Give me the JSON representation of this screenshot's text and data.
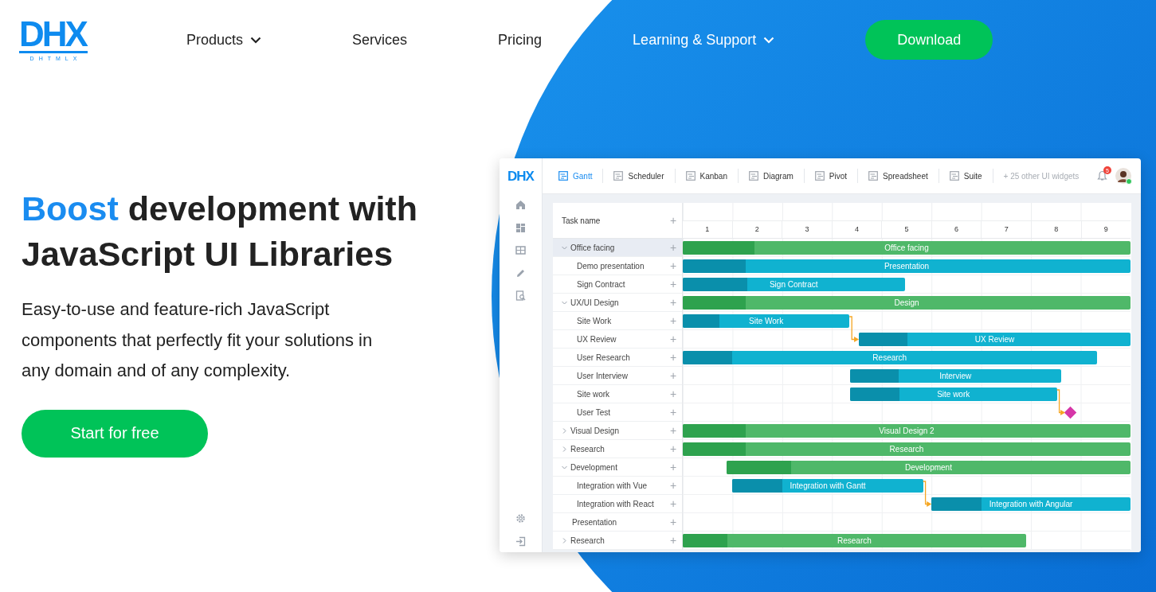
{
  "logo": {
    "mark": "DHX",
    "wordmark": "DHTMLX"
  },
  "nav": [
    {
      "label": "Products",
      "dropdown": true,
      "on_dark": false
    },
    {
      "label": "Services",
      "dropdown": false,
      "on_dark": false
    },
    {
      "label": "Pricing",
      "dropdown": false,
      "on_dark": false
    },
    {
      "label": "Learning & Support",
      "dropdown": true,
      "on_dark": true
    }
  ],
  "download_button": "Download",
  "hero": {
    "title_highlight": "Boost",
    "title_rest": "development with JavaScript UI Libraries",
    "text": "Easy-to-use and feature-rich JavaScript components that perfectly fit your solutions in any domain and of any complexity.",
    "button": "Start for free"
  },
  "app": {
    "logo": "DHX",
    "tabs": [
      {
        "label": "Gantt",
        "selected": true
      },
      {
        "label": "Scheduler",
        "selected": false
      },
      {
        "label": "Kanban",
        "selected": false
      },
      {
        "label": "Diagram",
        "selected": false
      },
      {
        "label": "Pivot",
        "selected": false
      },
      {
        "label": "Spreadsheet",
        "selected": false
      },
      {
        "label": "Suite",
        "selected": false
      }
    ],
    "more_link": "+ 25 other UI widgets",
    "notifications": "5",
    "user_online": true,
    "gantt": {
      "column_header": "Task name",
      "add_button": "+",
      "timeline": [
        "1",
        "2",
        "3",
        "4",
        "5",
        "6",
        "7",
        "8",
        "9"
      ],
      "rows": [
        {
          "name": "Office facing",
          "add_button": "+",
          "selected": true,
          "expanded": true,
          "bar": {
            "kind": "project",
            "label": "Office facing",
            "level": 0.16
          },
          "children": [
            {
              "name": "Demo presentation",
              "add_button": "+",
              "selected": false,
              "bar": {
                "kind": "task",
                "label": "Presentation",
                "level": 0.14
              }
            },
            {
              "name": "Sign Contract",
              "add_button": "+",
              "selected": false,
              "bar": {
                "kind": "task",
                "label": "Sign Contract",
                "level": 0.29
              }
            }
          ]
        },
        {
          "name": "UX/UI Design",
          "add_button": "+",
          "selected": false,
          "expanded": true,
          "bar": {
            "kind": "project",
            "label": "Design",
            "level": 0.14
          },
          "children": [
            {
              "name": "Site Work",
              "add_button": "+",
              "selected": false,
              "link_to_next": true,
              "bar": {
                "kind": "task",
                "label": "Site Work",
                "level": 0.22
              }
            },
            {
              "name": "UX Review",
              "add_button": "+",
              "selected": false,
              "bar": {
                "kind": "task",
                "label": "UX Review",
                "level": 0.18
              }
            },
            {
              "name": "User Research",
              "add_button": "+",
              "selected": false,
              "bar": {
                "kind": "task",
                "label": "Research",
                "level": 0.12
              }
            },
            {
              "name": "User Interview",
              "add_button": "+",
              "selected": false,
              "bar": {
                "kind": "task",
                "label": "Interview",
                "level": 0.23
              }
            },
            {
              "name": "Site work",
              "add_button": "+",
              "selected": false,
              "link_to_next": true,
              "bar": {
                "kind": "task",
                "label": "Site work",
                "level": 0.24
              }
            },
            {
              "name": "User Test",
              "add_button": "+",
              "selected": false,
              "bar": {
                "kind": "milestone"
              }
            }
          ]
        },
        {
          "name": "Visual Design",
          "add_button": "+",
          "selected": false,
          "expanded": false,
          "bar": {
            "kind": "project",
            "label": "Visual Design 2",
            "level": 0.14
          }
        },
        {
          "name": "Research",
          "add_button": "+",
          "selected": false,
          "expanded": false,
          "bar": {
            "kind": "project",
            "label": "Research",
            "level": 0.14
          }
        },
        {
          "name": "Development",
          "add_button": "+",
          "selected": false,
          "expanded": true,
          "bar": {
            "kind": "project",
            "label": "Development",
            "level": 0.16
          },
          "children": [
            {
              "name": "Integration with Vue",
              "add_button": "+",
              "selected": false,
              "link_to_next": true,
              "bar": {
                "kind": "task",
                "label": "Integration with Gantt",
                "level": 0.26
              }
            },
            {
              "name": "Integration with React",
              "add_button": "+",
              "selected": false,
              "bar": {
                "kind": "task",
                "label": "Integration with Angular",
                "level": 0.25
              }
            }
          ]
        },
        {
          "name": "Presentation",
          "add_button": "+",
          "selected": false
        },
        {
          "name": "Research",
          "add_button": "+",
          "selected": false,
          "expanded": false,
          "bar": {
            "kind": "project",
            "label": "Research",
            "level": 0.13
          }
        }
      ]
    }
  }
}
